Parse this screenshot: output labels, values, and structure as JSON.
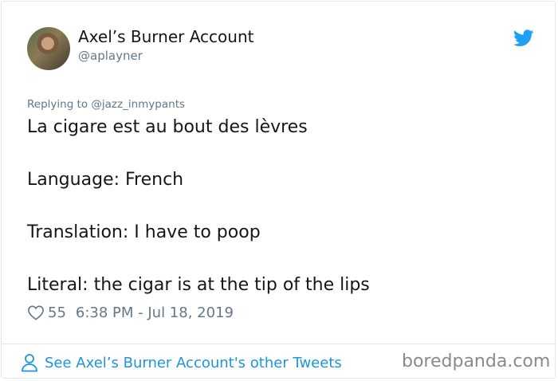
{
  "tweet": {
    "author_name": "Axel’s Burner Account",
    "author_handle": "@aplayner",
    "replying_prefix": "Replying to ",
    "replying_to": "@jazz_inmypants",
    "lines": [
      "La cigare est au bout des lèvres",
      "Language: French",
      "Translation: I have to poop",
      "Literal: the cigar is at the tip of the lips"
    ],
    "likes": "55",
    "timestamp": "6:38 PM - Jul 18, 2019"
  },
  "footer": {
    "see_more": "See Axel’s Burner Account's other Tweets"
  },
  "watermark": "boredpanda.com",
  "icons": {
    "brand": "twitter-bird-icon",
    "like": "heart-icon",
    "profile": "person-icon"
  },
  "colors": {
    "twitter_blue": "#1da1f2",
    "link_blue": "#1b95e0",
    "secondary_text": "#657786",
    "border": "#e1e8ed"
  }
}
